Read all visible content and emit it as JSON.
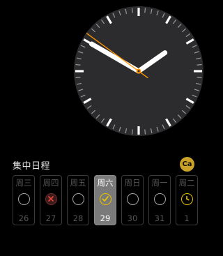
{
  "clock": {
    "hour": 1,
    "minute": 50,
    "second": 51,
    "accent_color": "#ff9500",
    "face_color": "#2c2c2e"
  },
  "focus": {
    "title": "集中日程",
    "app_badge": "Ca",
    "accent_color": "#e6c200",
    "days": [
      {
        "label": "周三",
        "date": "26",
        "status": "empty",
        "icon": "empty-circle-icon"
      },
      {
        "label": "周四",
        "date": "27",
        "status": "missed",
        "icon": "missed-x-icon"
      },
      {
        "label": "周五",
        "date": "28",
        "status": "empty",
        "icon": "empty-circle-icon"
      },
      {
        "label": "周六",
        "date": "29",
        "status": "done",
        "icon": "check-circle-icon",
        "active": true
      },
      {
        "label": "周日",
        "date": "30",
        "status": "empty",
        "icon": "empty-circle-icon"
      },
      {
        "label": "周一",
        "date": "31",
        "status": "empty",
        "icon": "empty-circle-icon"
      },
      {
        "label": "周二",
        "date": "1",
        "status": "progress",
        "icon": "timer-icon"
      }
    ]
  }
}
